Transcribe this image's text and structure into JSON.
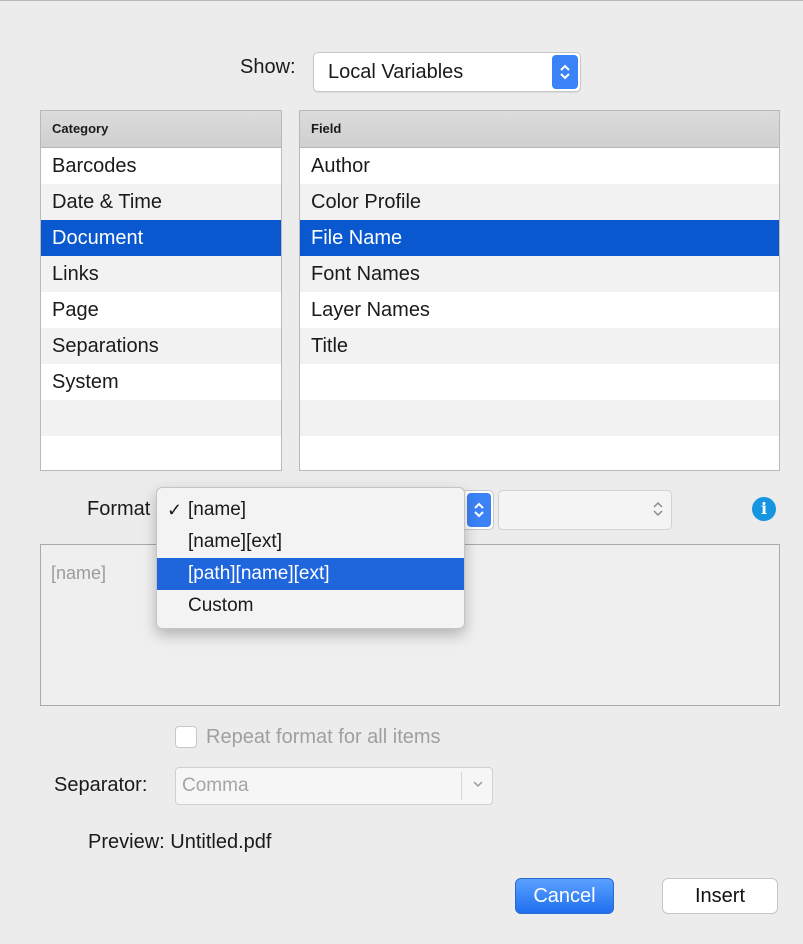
{
  "show": {
    "label": "Show:",
    "selected": "Local Variables"
  },
  "category": {
    "header": "Category",
    "items": [
      "Barcodes",
      "Date & Time",
      "Document",
      "Links",
      "Page",
      "Separations",
      "System"
    ],
    "selected": "Document"
  },
  "field": {
    "header": "Field",
    "items": [
      "Author",
      "Color Profile",
      "File Name",
      "Font Names",
      "Layer Names",
      "Title"
    ],
    "selected": "File Name"
  },
  "format": {
    "label": "Format",
    "menu_items": [
      "[name]",
      "[name][ext]",
      "[path][name][ext]",
      "Custom"
    ],
    "checked": "[name]",
    "highlighted": "[path][name][ext]",
    "info_icon": "i"
  },
  "textarea": {
    "value": "[name]"
  },
  "repeat_checkbox": {
    "label": "Repeat format for all items",
    "checked": false
  },
  "separator": {
    "label": "Separator:",
    "value": "Comma"
  },
  "preview": {
    "label": "Preview:",
    "value": "Untitled.pdf"
  },
  "buttons": {
    "cancel": "Cancel",
    "insert": "Insert"
  },
  "colors": {
    "selection": "#0a58d0",
    "accent": "#3b82f6",
    "info": "#1696e0"
  }
}
